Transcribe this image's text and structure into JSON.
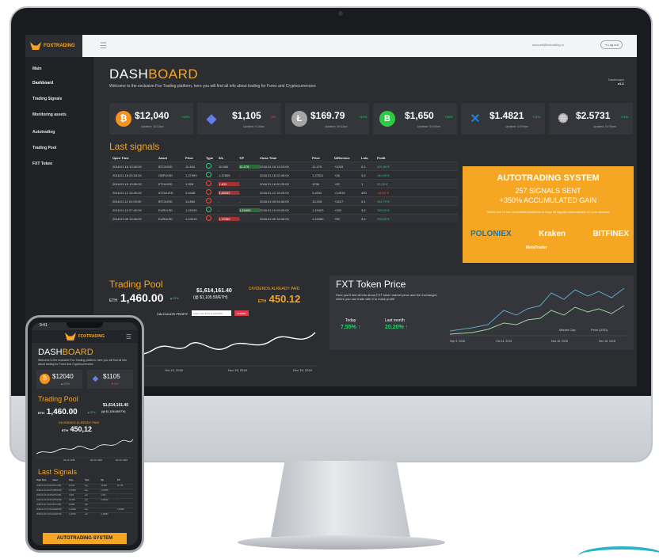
{
  "app": {
    "name": "FOXTRADING"
  },
  "topbar": {
    "account": "account@foxtrading.io",
    "logout": "⇥ Log out"
  },
  "sidebar": {
    "items": [
      {
        "label": "Main"
      },
      {
        "label": "Dashboard"
      },
      {
        "label": "Trading Signals"
      },
      {
        "label": "Monitoring assets"
      },
      {
        "label": "Autotrading"
      },
      {
        "label": "Trading Pool"
      },
      {
        "label": "FXT Token"
      }
    ]
  },
  "header": {
    "title_part1": "DASH",
    "title_part2": "BOARD",
    "subtitle": "Welcome to the exclusive Fox Trading platform, here you will find all info about trading for Forex and Cryptocurrencies",
    "breadcrumb_1": "Dashboard",
    "breadcrumb_2": "v1.2"
  },
  "prices": [
    {
      "symbol": "₿",
      "price": "$12,040",
      "change": "+22%",
      "color": "#f7931a",
      "updated": "Updated: 10:22pm"
    },
    {
      "symbol": "◆",
      "price": "$1,105",
      "change": "-3%",
      "color": "#627eea",
      "updated": "Updated: 9:10am"
    },
    {
      "symbol": "Ł",
      "price": "$169.79",
      "change": "+10%",
      "color": "#a6a6a6",
      "updated": "Updated: 09:42pm"
    },
    {
      "symbol": "B",
      "price": "$1,650",
      "change": "+15%",
      "color": "#2ecc40",
      "updated": "Updated: 04:00am"
    },
    {
      "symbol": "✕",
      "price": "$1.4821",
      "change": "+12%",
      "color": "#1d7fd6",
      "updated": "Updated: 04:00am"
    },
    {
      "symbol": "✺",
      "price": "$2.5731",
      "change": "+11%",
      "color": "#c9c9c9",
      "updated": "Updated: 04:00am"
    }
  ],
  "signals": {
    "title": "Last signals",
    "headers": [
      "Open Time",
      "Asset",
      "Price",
      "Type",
      "S/L",
      "T/P",
      "Close Time",
      "Price",
      "Difference",
      "Lots",
      "Profit"
    ],
    "rows": [
      [
        "2018.01.16 10:40:00",
        "BTC/USD",
        "11.464",
        "buy",
        "10.960",
        "12.475",
        "2018.01.16 13:13:00",
        "12.475",
        "+1015",
        "0,1",
        "101,50 €"
      ],
      [
        "2018.01.16 03:15:00",
        "GBP/USD",
        "1,37993",
        "buy",
        "1,37805",
        "-",
        "2018.01.16 02:45:00",
        "1,37921",
        "+28",
        "3,5",
        "140,00 €"
      ],
      [
        "2018.01.15 10:55:00",
        "ETH/USD",
        "1.328",
        "sell",
        "1.400",
        "-",
        "2018.01.16 00:20:00",
        "1236",
        "+92",
        "1",
        "92,00 €"
      ],
      [
        "2018.01.12 15:40:00",
        "IOTA/USD",
        "3,5448",
        "sell",
        "3,45532",
        "-",
        "2018.01.12 16:20:00",
        "3,4532",
        "-0,0916",
        "400",
        "-36,64 €"
      ],
      [
        "2018.01.11 01:00:00",
        "BTC/USD",
        "14.862",
        "sell",
        "-",
        "-",
        "2018.01.09 04:40:00",
        "13.245",
        "+1617",
        "0,1",
        "161,70 €"
      ],
      [
        "2018.01.10 07:40:00",
        "EUR/USD",
        "1,19249",
        "buy",
        "-",
        "1,19400",
        "2018.01.10 09:00:00",
        "1,19403",
        "+153",
        "3,5",
        "765,00 €"
      ],
      [
        "2018.01.09 13:40:00",
        "EUR/USD",
        "1,19319",
        "sell",
        "1,19380",
        "-",
        "2018.01.09 15:00:00",
        "1,19260",
        "+59",
        "3,5",
        "295,00 €"
      ]
    ]
  },
  "autotrading": {
    "title": "AUTOTRADING SYSTEM",
    "line1": "257 SIGNALS SENT",
    "line2": "+350% ACCUMULATED GAIN",
    "small": "Select one of our compatible platforms to copy all signals automatically on your account",
    "partners": [
      "POLONIEX",
      "Kraken",
      "BITFINEX"
    ],
    "metatrader": "MetaTrader"
  },
  "pool": {
    "title": "Trading Pool",
    "eth_prefix": "ETH",
    "eth_value": "1,460.00",
    "pct": "▲22%",
    "usd": "$1,614,161.40",
    "usd_eth": "(@ $1,105.59/ETH)",
    "dividends_label": "DIVIDENDS ALREADY PAID",
    "dividends_prefix": "ETH",
    "dividends_value": "450.12",
    "calc_label": "CALCULATE PROFIT:",
    "calc_placeholder": "Insert your ETH to calculate",
    "calc_button": "SUBMIT",
    "x_labels": [
      "Oct 14, 2018",
      "Nov 16, 2018",
      "Dec 16, 2018"
    ]
  },
  "fxt": {
    "title": "FXT Token Price",
    "desc": "Here you'll find all info about FXT token market price and the exchanges where you can trade with it to make profit!",
    "today_label": "Today",
    "month_label": "Last month",
    "today_value": "7,55% ↑",
    "month_value": "20,20% ↑",
    "legend_1": "Market Cap",
    "legend_2": "Price (USD)",
    "x_labels": [
      "Sep 9, 2018",
      "Oct 14, 2018",
      "Nov 16, 2018",
      "Dec 16, 2018"
    ]
  },
  "phone": {
    "time": "9:41",
    "dash_part1": "DASH",
    "dash_part2": "BOARD",
    "sub": "Welcome to the exclusive Fox Trading platform, here you will find all info about trading for Forex and Cryptocurrencies",
    "price1": "$12040",
    "change1": "▲22%",
    "price2": "$1105",
    "change2": "▼3%",
    "pool_title": "Trading Pool",
    "eth": "ETH",
    "eth_value": "1,460.00",
    "pct": "▲22%",
    "usd": "$1,614,161.40",
    "usd_eth": "(@ $1,105.59/ETH)",
    "div_label": "DIVIDENDS ALREADY PAID",
    "div_prefix": "ETH",
    "div_value": "450,12",
    "signals_title": "Last Signals",
    "table_headers": [
      "Open Time",
      "Asset",
      "Price",
      "Type",
      "S/L",
      "T/P"
    ],
    "auto_button": "AUTOTRADING SYSTEM"
  }
}
